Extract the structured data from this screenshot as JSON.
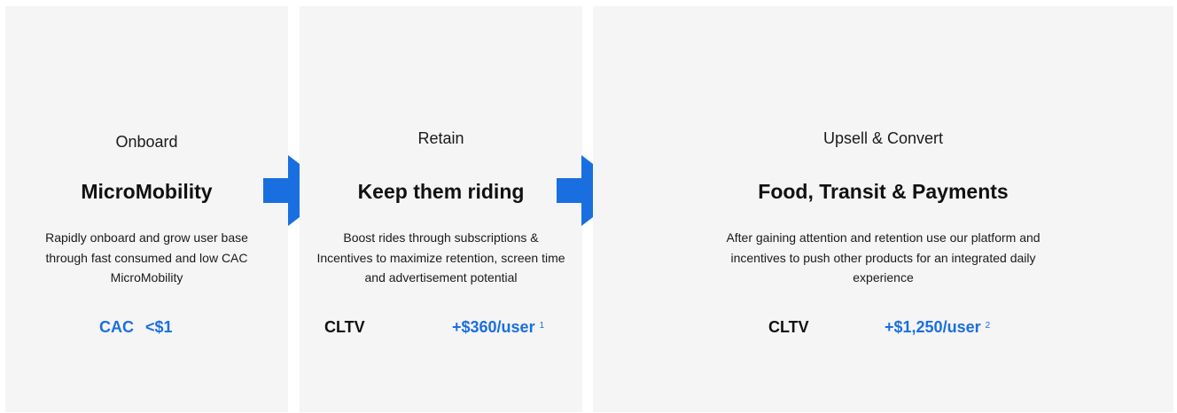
{
  "stages": [
    {
      "label": "Onboard",
      "title": "MicroMobility",
      "description": "Rapidly onboard and grow user base through fast consumed and low CAC MicroMobility",
      "metric_name": "CAC",
      "metric_value": "<$1",
      "footnote": ""
    },
    {
      "label": "Retain",
      "title": "Keep them riding",
      "description": "Boost rides through subscriptions & Incentives to maximize retention, screen time and advertisement potential",
      "metric_name": "CLTV",
      "metric_value": "+$360/user",
      "footnote": "1"
    },
    {
      "label": "Upsell & Convert",
      "title": "Food, Transit & Payments",
      "description": "After gaining attention and retention use our platform and incentives to push other products for an integrated daily experience",
      "metric_name": "CLTV",
      "metric_value": "+$1,250/user",
      "footnote": "2"
    }
  ],
  "colors": {
    "accent": "#1a6fe0",
    "panel_bg": "#f5f5f5",
    "text": "#111111"
  },
  "icons": {
    "arrow": "arrow-right-icon"
  }
}
